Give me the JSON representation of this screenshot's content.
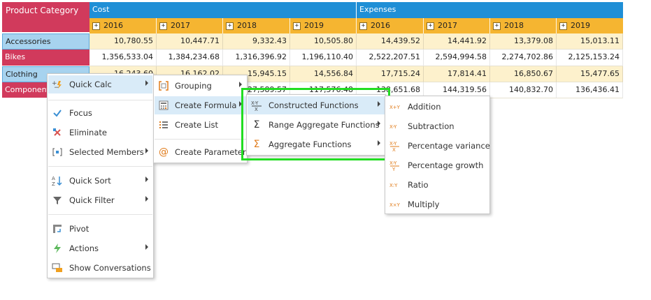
{
  "grid": {
    "corner": "Product Category",
    "groups": [
      "Cost",
      "Expenses"
    ],
    "years": [
      "2016",
      "2017",
      "2018",
      "2019",
      "2016",
      "2017",
      "2018",
      "2019"
    ],
    "rows": [
      {
        "label": "Accessories",
        "values": [
          "10,780.55",
          "10,447.71",
          "9,332.43",
          "10,505.80",
          "14,439.52",
          "14,441.92",
          "13,379.08",
          "15,013.11"
        ]
      },
      {
        "label": "Bikes",
        "values": [
          "1,356,533.04",
          "1,384,234.68",
          "1,316,396.92",
          "1,196,110.40",
          "2,522,207.51",
          "2,594,994.58",
          "2,274,702.86",
          "2,125,153.24"
        ]
      },
      {
        "label": "Clothing",
        "values": [
          "16,243.60",
          "16,162.02",
          "15,945.15",
          "14,556.84",
          "17,715.24",
          "17,814.41",
          "16,850.67",
          "15,477.65"
        ]
      },
      {
        "label": "Components",
        "values": [
          "",
          "",
          "127,589.57",
          "117,576.48",
          "138,651.68",
          "144,319.56",
          "140,832.70",
          "136,436.41"
        ]
      }
    ]
  },
  "menu1": {
    "items": [
      {
        "label": "Quick Calc",
        "icon": "quick-calc-icon"
      },
      {
        "label": "Focus",
        "icon": "focus-icon"
      },
      {
        "label": "Eliminate",
        "icon": "eliminate-icon"
      },
      {
        "label": "Selected Members",
        "icon": "selected-members-icon"
      },
      {
        "label": "Quick Sort",
        "icon": "sort-icon"
      },
      {
        "label": "Quick Filter",
        "icon": "filter-icon"
      },
      {
        "label": "Pivot",
        "icon": "pivot-icon"
      },
      {
        "label": "Actions",
        "icon": "actions-icon"
      },
      {
        "label": "Show Conversations",
        "icon": "conversations-icon"
      }
    ]
  },
  "menu2": {
    "items": [
      {
        "label": "Grouping",
        "icon": "grouping-icon"
      },
      {
        "label": "Create Formula",
        "icon": "formula-icon"
      },
      {
        "label": "Create List",
        "icon": "list-icon"
      },
      {
        "label": "Create Parameter",
        "icon": "parameter-icon"
      }
    ]
  },
  "menu3": {
    "items": [
      {
        "label": "Constructed Functions",
        "icon": "constructed-functions-icon"
      },
      {
        "label": "Range Aggregate Functions",
        "icon": "range-aggregate-icon"
      },
      {
        "label": "Aggregate Functions",
        "icon": "aggregate-icon"
      }
    ]
  },
  "menu4": {
    "items": [
      {
        "label": "Addition",
        "icon": "addition-icon"
      },
      {
        "label": "Subtraction",
        "icon": "subtraction-icon"
      },
      {
        "label": "Percentage variance",
        "icon": "percentage-variance-icon"
      },
      {
        "label": "Percentage growth",
        "icon": "percentage-growth-icon"
      },
      {
        "label": "Ratio",
        "icon": "ratio-icon"
      },
      {
        "label": "Multiply",
        "icon": "multiply-icon"
      }
    ]
  },
  "colors": {
    "accent_blue": "#1f8fd6",
    "category_red": "#d13a5c",
    "year_orange": "#f5b531",
    "highlight_green": "#22dd22"
  }
}
